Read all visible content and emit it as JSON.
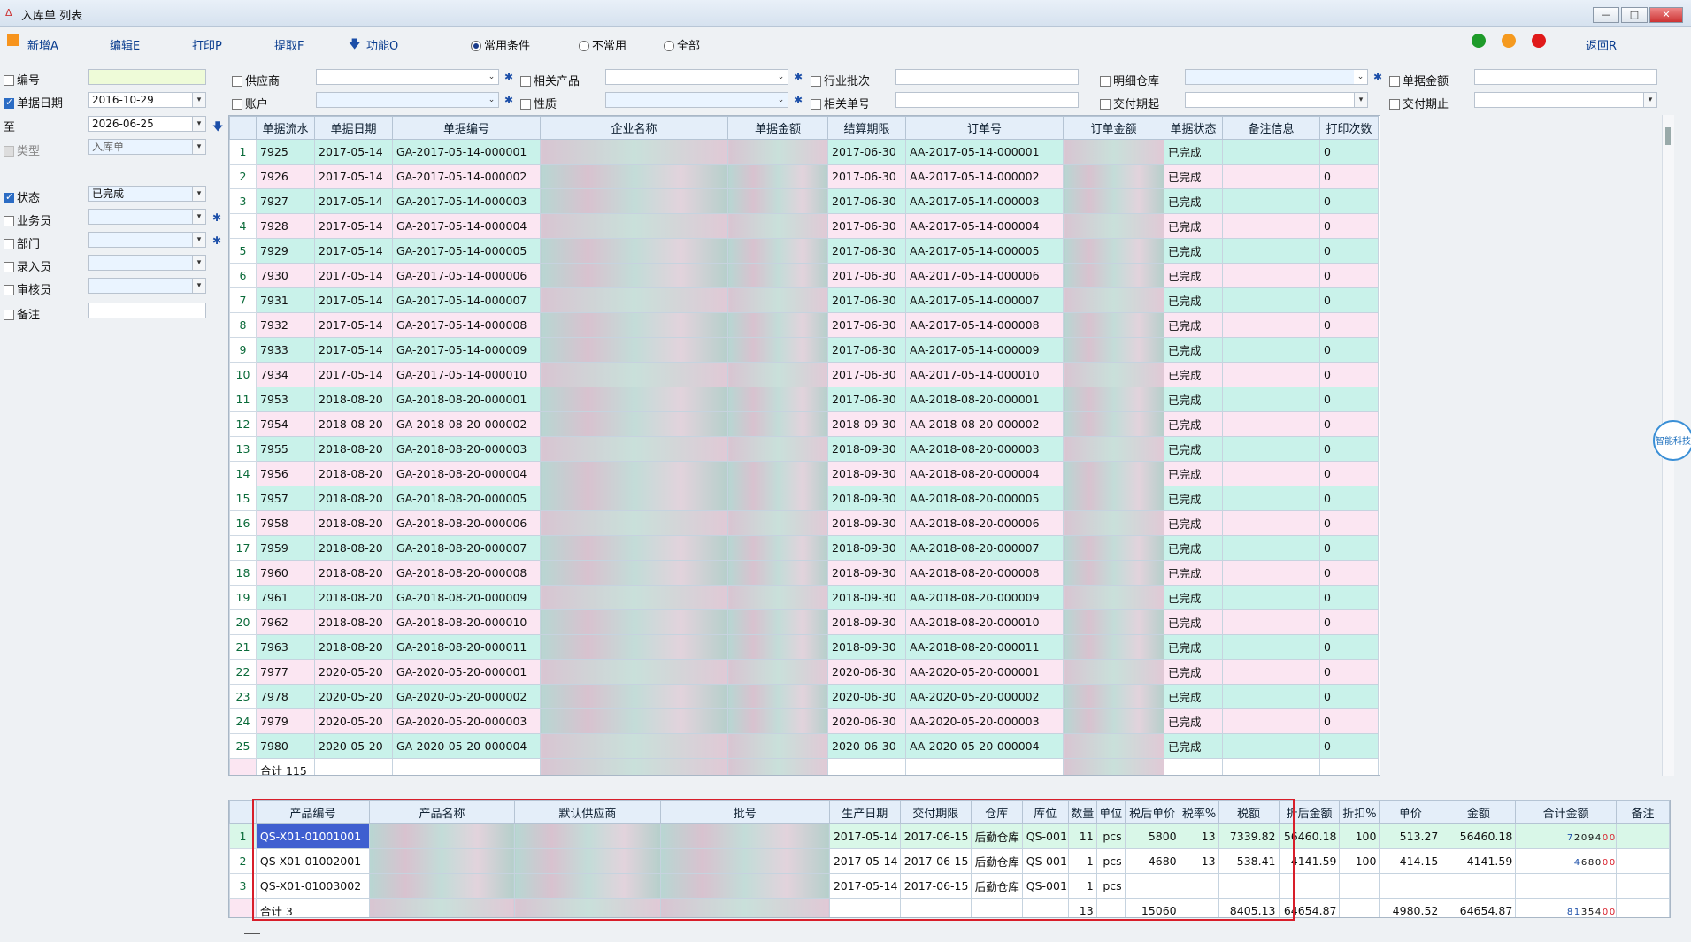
{
  "window": {
    "title": "入库单 列表",
    "min": "—",
    "max": "□",
    "close": "✕"
  },
  "toolbar": {
    "new": "新增A",
    "edit": "编辑E",
    "print": "打印P",
    "extract": "提取F",
    "func": "功能O",
    "return": "返回R",
    "radios": [
      {
        "label": "常用条件",
        "checked": true
      },
      {
        "label": "不常用",
        "checked": false
      },
      {
        "label": "全部",
        "checked": false
      }
    ],
    "dots": [
      "#1e9b2a",
      "#f59a1f",
      "#e01a1a"
    ]
  },
  "left": {
    "code_label": "编号",
    "date_label": "单据日期",
    "date_from": "2016-10-29",
    "to_label": "至",
    "date_to": "2026-06-25",
    "type_label": "类型",
    "type_value": "入库单",
    "status_label": "状态",
    "status_value": "已完成",
    "salesman_label": "业务员",
    "dept_label": "部门",
    "entry_label": "录入员",
    "auditor_label": "审核员",
    "remark_label": "备注"
  },
  "filters": {
    "supplier": "供应商",
    "account": "账户",
    "related_product": "相关产品",
    "nature": "性质",
    "industry_batch": "行业批次",
    "related_no": "相关单号",
    "detail_wh": "明细仓库",
    "delivery_from": "交付期起",
    "doc_amount": "单据金额",
    "delivery_to": "交付期止"
  },
  "grid": {
    "headers": [
      "",
      "单据流水",
      "单据日期",
      "单据编号",
      "企业名称",
      "单据金额",
      "结算期限",
      "订单号",
      "订单金额",
      "单据状态",
      "备注信息",
      "打印次数"
    ],
    "rows": [
      [
        "1",
        "7925",
        "2017-05-14",
        "GA-2017-05-14-000001",
        "2017-06-30",
        "AA-2017-05-14-000001",
        "已完成",
        "0"
      ],
      [
        "2",
        "7926",
        "2017-05-14",
        "GA-2017-05-14-000002",
        "2017-06-30",
        "AA-2017-05-14-000002",
        "已完成",
        "0"
      ],
      [
        "3",
        "7927",
        "2017-05-14",
        "GA-2017-05-14-000003",
        "2017-06-30",
        "AA-2017-05-14-000003",
        "已完成",
        "0"
      ],
      [
        "4",
        "7928",
        "2017-05-14",
        "GA-2017-05-14-000004",
        "2017-06-30",
        "AA-2017-05-14-000004",
        "已完成",
        "0"
      ],
      [
        "5",
        "7929",
        "2017-05-14",
        "GA-2017-05-14-000005",
        "2017-06-30",
        "AA-2017-05-14-000005",
        "已完成",
        "0"
      ],
      [
        "6",
        "7930",
        "2017-05-14",
        "GA-2017-05-14-000006",
        "2017-06-30",
        "AA-2017-05-14-000006",
        "已完成",
        "0"
      ],
      [
        "7",
        "7931",
        "2017-05-14",
        "GA-2017-05-14-000007",
        "2017-06-30",
        "AA-2017-05-14-000007",
        "已完成",
        "0"
      ],
      [
        "8",
        "7932",
        "2017-05-14",
        "GA-2017-05-14-000008",
        "2017-06-30",
        "AA-2017-05-14-000008",
        "已完成",
        "0"
      ],
      [
        "9",
        "7933",
        "2017-05-14",
        "GA-2017-05-14-000009",
        "2017-06-30",
        "AA-2017-05-14-000009",
        "已完成",
        "0"
      ],
      [
        "10",
        "7934",
        "2017-05-14",
        "GA-2017-05-14-000010",
        "2017-06-30",
        "AA-2017-05-14-000010",
        "已完成",
        "0"
      ],
      [
        "11",
        "7953",
        "2018-08-20",
        "GA-2018-08-20-000001",
        "2017-06-30",
        "AA-2018-08-20-000001",
        "已完成",
        "0"
      ],
      [
        "12",
        "7954",
        "2018-08-20",
        "GA-2018-08-20-000002",
        "2018-09-30",
        "AA-2018-08-20-000002",
        "已完成",
        "0"
      ],
      [
        "13",
        "7955",
        "2018-08-20",
        "GA-2018-08-20-000003",
        "2018-09-30",
        "AA-2018-08-20-000003",
        "已完成",
        "0"
      ],
      [
        "14",
        "7956",
        "2018-08-20",
        "GA-2018-08-20-000004",
        "2018-09-30",
        "AA-2018-08-20-000004",
        "已完成",
        "0"
      ],
      [
        "15",
        "7957",
        "2018-08-20",
        "GA-2018-08-20-000005",
        "2018-09-30",
        "AA-2018-08-20-000005",
        "已完成",
        "0"
      ],
      [
        "16",
        "7958",
        "2018-08-20",
        "GA-2018-08-20-000006",
        "2018-09-30",
        "AA-2018-08-20-000006",
        "已完成",
        "0"
      ],
      [
        "17",
        "7959",
        "2018-08-20",
        "GA-2018-08-20-000007",
        "2018-09-30",
        "AA-2018-08-20-000007",
        "已完成",
        "0"
      ],
      [
        "18",
        "7960",
        "2018-08-20",
        "GA-2018-08-20-000008",
        "2018-09-30",
        "AA-2018-08-20-000008",
        "已完成",
        "0"
      ],
      [
        "19",
        "7961",
        "2018-08-20",
        "GA-2018-08-20-000009",
        "2018-09-30",
        "AA-2018-08-20-000009",
        "已完成",
        "0"
      ],
      [
        "20",
        "7962",
        "2018-08-20",
        "GA-2018-08-20-000010",
        "2018-09-30",
        "AA-2018-08-20-000010",
        "已完成",
        "0"
      ],
      [
        "21",
        "7963",
        "2018-08-20",
        "GA-2018-08-20-000011",
        "2018-09-30",
        "AA-2018-08-20-000011",
        "已完成",
        "0"
      ],
      [
        "22",
        "7977",
        "2020-05-20",
        "GA-2020-05-20-000001",
        "2020-06-30",
        "AA-2020-05-20-000001",
        "已完成",
        "0"
      ],
      [
        "23",
        "7978",
        "2020-05-20",
        "GA-2020-05-20-000002",
        "2020-06-30",
        "AA-2020-05-20-000002",
        "已完成",
        "0"
      ],
      [
        "24",
        "7979",
        "2020-05-20",
        "GA-2020-05-20-000003",
        "2020-06-30",
        "AA-2020-05-20-000003",
        "已完成",
        "0"
      ],
      [
        "25",
        "7980",
        "2020-05-20",
        "GA-2020-05-20-000004",
        "2020-06-30",
        "AA-2020-05-20-000004",
        "已完成",
        "0"
      ]
    ],
    "total": "合计 115"
  },
  "detail": {
    "headers": [
      "",
      "产品编号",
      "产品名称",
      "默认供应商",
      "批号",
      "生产日期",
      "交付期限",
      "仓库",
      "库位",
      "数量",
      "单位",
      "税后单价",
      "税率%",
      "税额",
      "折后金额",
      "折扣%",
      "单价",
      "金额",
      "合计金额",
      "备注"
    ],
    "rows": [
      [
        "1",
        "QS-X01-01001001",
        "2017-05-14",
        "2017-06-15",
        "后勤仓库",
        "QS-001",
        "11",
        "pcs",
        "5800",
        "13",
        "7339.82",
        "56460.18",
        "100",
        "513.27",
        "56460.18"
      ],
      [
        "2",
        "QS-X01-01002001",
        "2017-05-14",
        "2017-06-15",
        "后勤仓库",
        "QS-001",
        "1",
        "pcs",
        "4680",
        "13",
        "538.41",
        "4141.59",
        "100",
        "414.15",
        "4141.59"
      ],
      [
        "3",
        "QS-X01-01003002",
        "2017-05-14",
        "2017-06-15",
        "后勤仓库",
        "QS-001",
        "1",
        "pcs",
        "",
        "",
        "",
        "",
        "",
        "",
        ""
      ]
    ],
    "amount_digits": [
      [
        "7",
        "2",
        "0",
        "9",
        "4",
        "0",
        "0"
      ],
      [
        "4",
        "6",
        "8",
        "0",
        "0",
        "0"
      ]
    ],
    "total": {
      "label": "合计 3",
      "qty": "13",
      "price": "15060",
      "tax": "8405.13",
      "disc": "64654.87",
      "unit": "4980.52",
      "amount": "64654.87",
      "digits": [
        "8",
        "1",
        "3",
        "5",
        "4",
        "0",
        "0"
      ]
    }
  },
  "badge": "智能科技"
}
